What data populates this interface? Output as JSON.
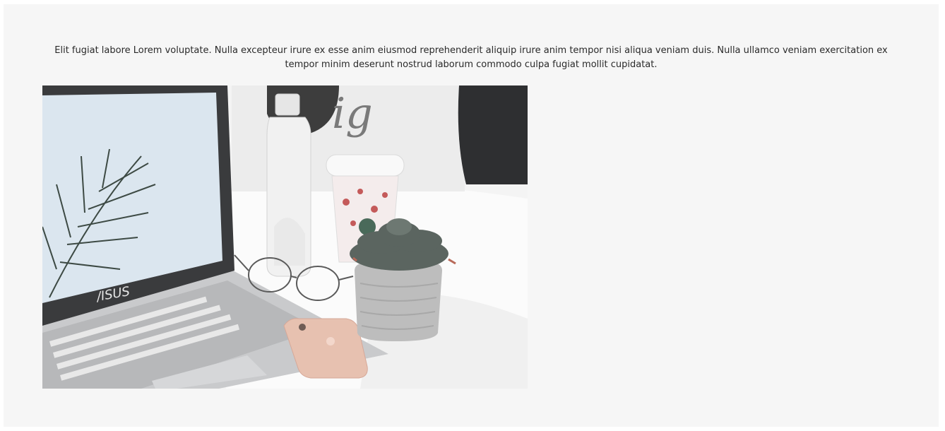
{
  "content": {
    "paragraph": "Elit fugiat labore Lorem voluptate. Nulla excepteur irure ex esse anim eiusmod reprehenderit aliquip irure anim tempor nisi aliqua veniam duis. Nulla ullamco veniam exercitation ex tempor minim deserunt nostrud laborum commodo culpa fugiat mollit cupidatat."
  },
  "photo": {
    "laptop_brand": "/ISUS",
    "tote_lettering": "ig",
    "colors": {
      "background": "#f6f6f6",
      "laptop_body": "#c9cacc",
      "laptop_bezel": "#3a3b3d",
      "screen": "#dbe6ef",
      "phone": "#e7c1b0",
      "succulent": "#5b6560",
      "pot": "#bdbdbd"
    }
  }
}
